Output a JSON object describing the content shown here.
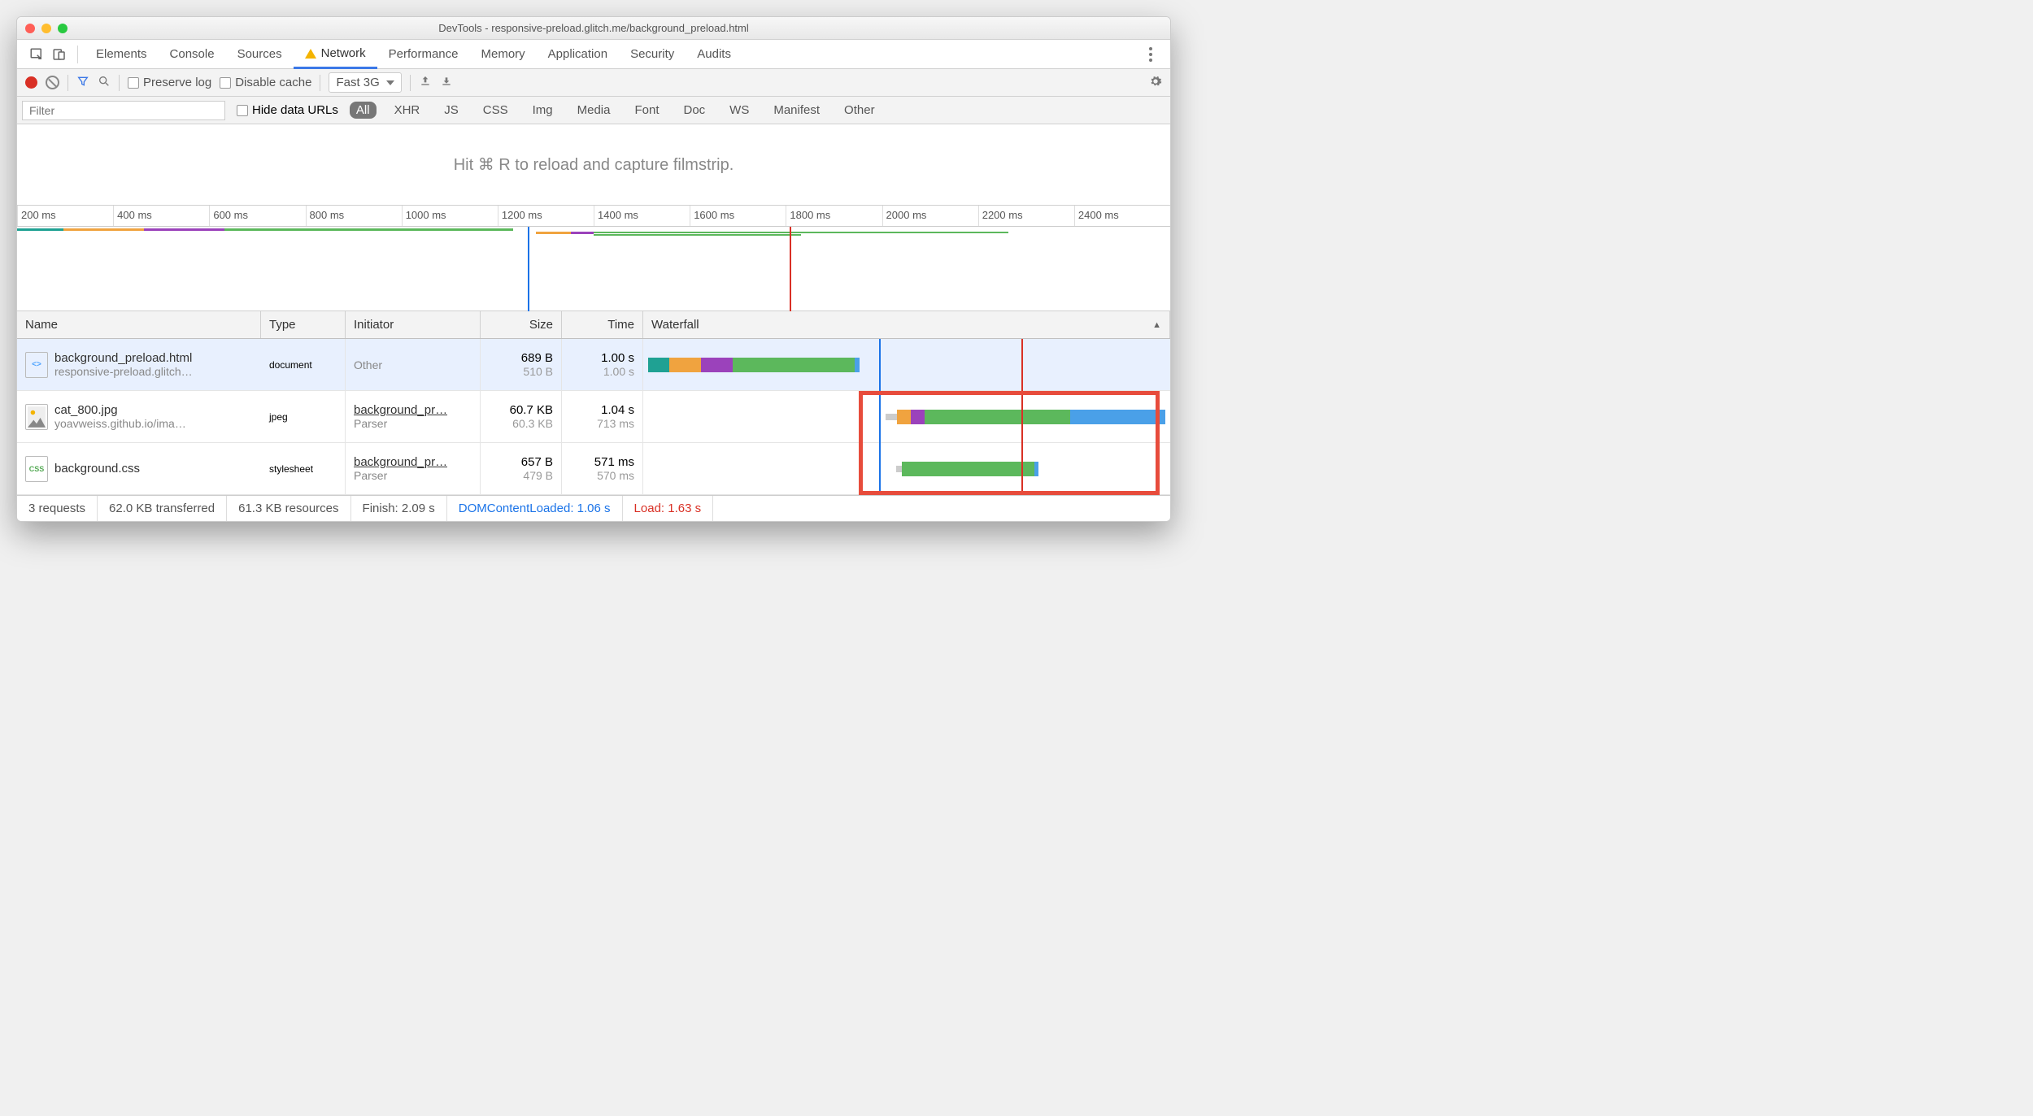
{
  "window": {
    "title": "DevTools - responsive-preload.glitch.me/background_preload.html"
  },
  "tabs": {
    "elements": "Elements",
    "console": "Console",
    "sources": "Sources",
    "network": "Network",
    "performance": "Performance",
    "memory": "Memory",
    "application": "Application",
    "security": "Security",
    "audits": "Audits"
  },
  "toolbar": {
    "preserve_log": "Preserve log",
    "disable_cache": "Disable cache",
    "throttling": "Fast 3G"
  },
  "filterbar": {
    "placeholder": "Filter",
    "hide_data_urls": "Hide data URLs",
    "types": {
      "all": "All",
      "xhr": "XHR",
      "js": "JS",
      "css": "CSS",
      "img": "Img",
      "media": "Media",
      "font": "Font",
      "doc": "Doc",
      "ws": "WS",
      "manifest": "Manifest",
      "other": "Other"
    }
  },
  "filmstrip": {
    "hint": "Hit ⌘ R to reload and capture filmstrip."
  },
  "ruler": {
    "ticks": [
      "200 ms",
      "400 ms",
      "600 ms",
      "800 ms",
      "1000 ms",
      "1200 ms",
      "1400 ms",
      "1600 ms",
      "1800 ms",
      "2000 ms",
      "2200 ms",
      "2400 ms"
    ]
  },
  "columns": {
    "name": "Name",
    "type": "Type",
    "initiator": "Initiator",
    "size": "Size",
    "time": "Time",
    "waterfall": "Waterfall"
  },
  "rows": [
    {
      "name": "background_preload.html",
      "sub": "responsive-preload.glitch…",
      "type": "document",
      "initiator": "Other",
      "initiator_sub": "",
      "size": "689 B",
      "size_sub": "510 B",
      "time": "1.00 s",
      "time_sub": "1.00 s"
    },
    {
      "name": "cat_800.jpg",
      "sub": "yoavweiss.github.io/ima…",
      "type": "jpeg",
      "initiator": "background_pr…",
      "initiator_sub": "Parser",
      "size": "60.7 KB",
      "size_sub": "60.3 KB",
      "time": "1.04 s",
      "time_sub": "713 ms"
    },
    {
      "name": "background.css",
      "sub": "",
      "type": "stylesheet",
      "initiator": "background_pr…",
      "initiator_sub": "Parser",
      "size": "657 B",
      "size_sub": "479 B",
      "time": "571 ms",
      "time_sub": "570 ms"
    }
  ],
  "status": {
    "requests": "3 requests",
    "transferred": "62.0 KB transferred",
    "resources": "61.3 KB resources",
    "finish": "Finish: 2.09 s",
    "dcl": "DOMContentLoaded: 1.06 s",
    "load": "Load: 1.63 s"
  },
  "colors": {
    "green": "#5cb85c",
    "orange": "#f0a33f",
    "purple": "#9b42bb",
    "teal": "#1fa193",
    "blue": "#4aa0e8",
    "red": "#d93025",
    "dcl_blue": "#1a73e8"
  }
}
